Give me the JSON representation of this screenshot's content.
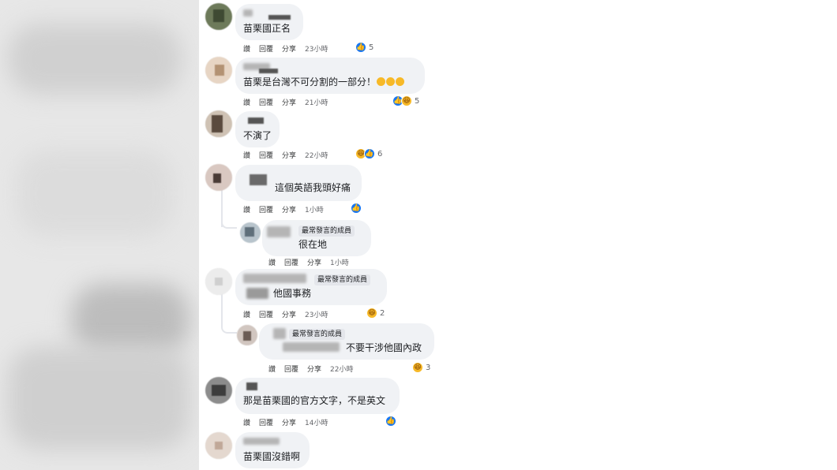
{
  "actions": {
    "like": "讚",
    "reply": "回覆",
    "share": "分享"
  },
  "comments": [
    {
      "text": "苗栗國正名",
      "time": "23小時",
      "reaction_count": "5",
      "reactions": [
        "like"
      ]
    },
    {
      "text": "苗栗是台灣不可分割的一部分！",
      "time": "21小時",
      "reaction_count": "5",
      "reactions": [
        "like",
        "haha"
      ]
    },
    {
      "text": "不演了",
      "time": "22小時",
      "reaction_count": "6",
      "reactions": [
        "haha",
        "like"
      ]
    },
    {
      "text": "這個英語我頭好痛",
      "time": "1小時",
      "reaction_count": "",
      "reactions": [
        "like"
      ]
    },
    {
      "badge": "最常發言的成員",
      "text": "很在地",
      "time": "1小時",
      "reaction_count": "",
      "reactions": []
    },
    {
      "badge": "最常發言的成員",
      "text": "他國事務",
      "time": "23小時",
      "reaction_count": "2",
      "reactions": [
        "haha"
      ]
    },
    {
      "badge": "最常發言的成員",
      "text": "不要干涉他國內政",
      "time": "22小時",
      "reaction_count": "3",
      "reactions": [
        "haha"
      ]
    },
    {
      "text": "那是苗栗國的官方文字，不是英文",
      "time": "14小時",
      "reaction_count": "",
      "reactions": [
        "like"
      ]
    },
    {
      "text": "苗栗國沒錯啊"
    }
  ],
  "colors": {
    "bubble": "#f0f2f5",
    "like": "#1877f2",
    "haha": "#f7b928",
    "time": "#65676b"
  }
}
